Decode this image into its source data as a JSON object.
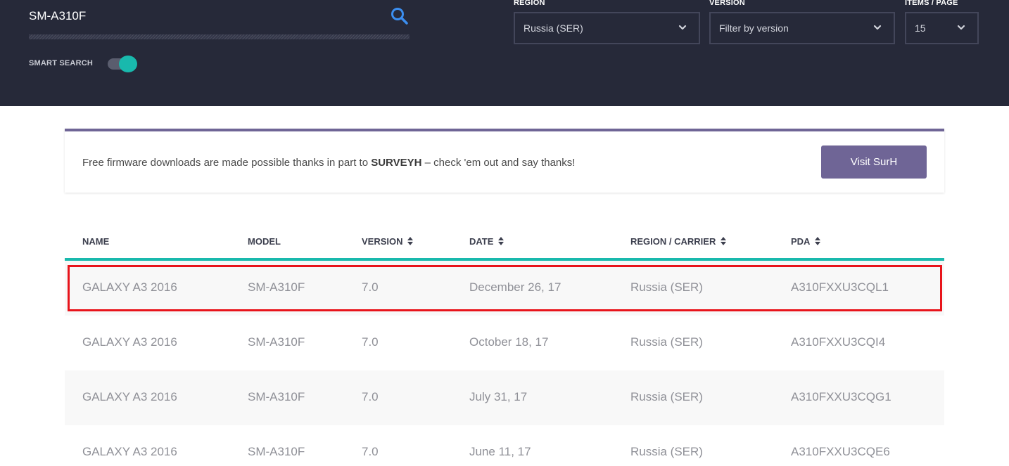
{
  "search": {
    "value": "SM-A310F",
    "smart_search_label": "SMART SEARCH",
    "smart_search_on": true
  },
  "filters": {
    "region": {
      "label": "REGION",
      "value": "Russia (SER)"
    },
    "version": {
      "label": "VERSION",
      "value": "Filter by version"
    },
    "items_per_page": {
      "label": "ITEMS / PAGE",
      "value": "15"
    }
  },
  "sponsor": {
    "text_before": "Free firmware downloads are made possible thanks in part to ",
    "brand": "SURVEYH",
    "text_after": " – check 'em out and say thanks!",
    "button_label": "Visit SurH"
  },
  "table": {
    "headers": {
      "name": "NAME",
      "model": "MODEL",
      "version": "VERSION",
      "date": "DATE",
      "region": "REGION / CARRIER",
      "pda": "PDA"
    },
    "rows": [
      {
        "name": "GALAXY A3 2016",
        "model": "SM-A310F",
        "version": "7.0",
        "date": "December 26, 17",
        "region": "Russia (SER)",
        "pda": "A310FXXU3CQL1"
      },
      {
        "name": "GALAXY A3 2016",
        "model": "SM-A310F",
        "version": "7.0",
        "date": "October 18, 17",
        "region": "Russia (SER)",
        "pda": "A310FXXU3CQI4"
      },
      {
        "name": "GALAXY A3 2016",
        "model": "SM-A310F",
        "version": "7.0",
        "date": "July 31, 17",
        "region": "Russia (SER)",
        "pda": "A310FXXU3CQG1"
      },
      {
        "name": "GALAXY A3 2016",
        "model": "SM-A310F",
        "version": "7.0",
        "date": "June 11, 17",
        "region": "Russia (SER)",
        "pda": "A310FXXU3CQE6"
      }
    ]
  },
  "colors": {
    "header_bg": "#262939",
    "accent_teal": "#19b9ad",
    "accent_purple": "#6f6596",
    "highlight_red": "#e8141b",
    "search_icon": "#3b8ef0"
  },
  "icons": {
    "search": "search-icon",
    "chevron": "chevron-down-icon",
    "sort": "sort-icon"
  }
}
